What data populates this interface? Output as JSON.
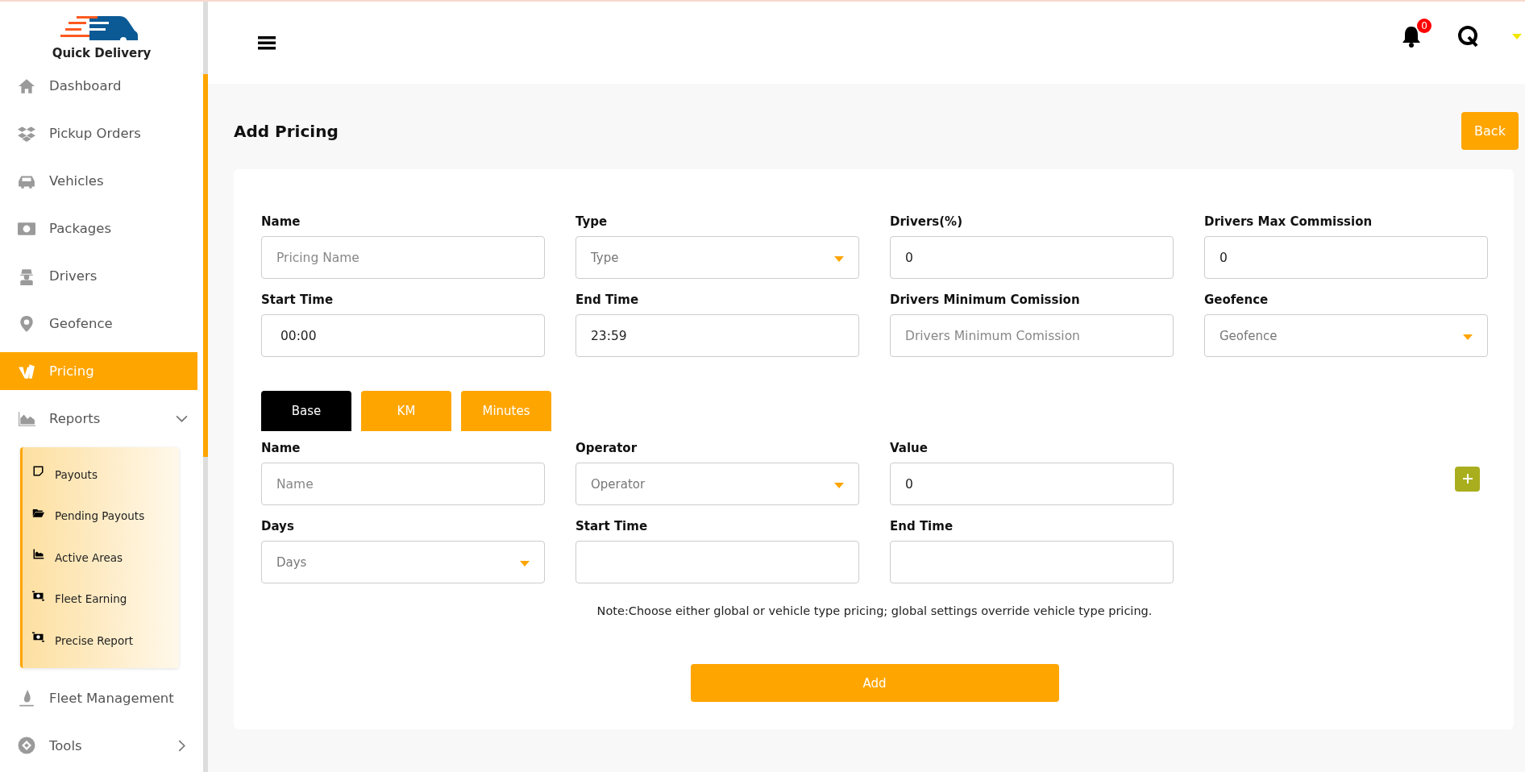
{
  "brand": {
    "name": "Quick Delivery"
  },
  "sidebar": {
    "items": [
      {
        "label": "Dashboard",
        "selected": false
      },
      {
        "label": "Pickup Orders",
        "selected": false
      },
      {
        "label": "Vehicles",
        "selected": false
      },
      {
        "label": "Packages",
        "selected": false
      },
      {
        "label": "Drivers",
        "selected": false
      },
      {
        "label": "Geofence",
        "selected": false
      },
      {
        "label": "Pricing",
        "selected": true
      },
      {
        "label": "Reports",
        "selected": false,
        "expanded": true,
        "children": [
          {
            "label": "Payouts",
            "selected": false
          },
          {
            "label": "Pending Payouts",
            "selected": false
          },
          {
            "label": "Active Areas",
            "selected": false
          },
          {
            "label": "Fleet Earning",
            "selected": false
          },
          {
            "label": "Precise Report",
            "selected": false
          }
        ]
      },
      {
        "label": "Fleet Management",
        "selected": false
      },
      {
        "label": "Tools",
        "selected": false,
        "expanded": false
      }
    ]
  },
  "header": {
    "notifications": "0"
  },
  "page": {
    "title": "Add Pricing",
    "back_button": "Back"
  },
  "form": {
    "fields": [
      {
        "label": "Name",
        "kind": "text",
        "placeholder": "Pricing Name"
      },
      {
        "label": "Type",
        "kind": "select",
        "placeholder": "Type"
      },
      {
        "label": "Drivers(%)",
        "kind": "text",
        "value": "0"
      },
      {
        "label": "Drivers Max Commission",
        "kind": "text",
        "value": "0"
      },
      {
        "label": "Start Time",
        "kind": "text",
        "value": " 00:00"
      },
      {
        "label": "End Time",
        "kind": "text",
        "value": "23:59"
      },
      {
        "label": "Drivers Minimum Comission",
        "kind": "text",
        "placeholder": "Drivers Minimum Comission"
      },
      {
        "label": "Geofence",
        "kind": "select",
        "placeholder": "Geofence"
      }
    ],
    "tabs": [
      {
        "label": "Base",
        "selected": true
      },
      {
        "label": "KM",
        "selected": false
      },
      {
        "label": "Minutes",
        "selected": false
      }
    ],
    "rule_fields": [
      {
        "label": "Name",
        "kind": "text",
        "placeholder": "Name"
      },
      {
        "label": "Operator",
        "kind": "select",
        "placeholder": "Operator"
      },
      {
        "label": "Value",
        "kind": "text",
        "value": "0"
      },
      {
        "kind": "add"
      },
      {
        "label": "Days",
        "kind": "select",
        "placeholder": "Days"
      },
      {
        "label": "Start Time",
        "kind": "text"
      },
      {
        "label": "End Time",
        "kind": "text"
      }
    ],
    "note": "Note:Choose either global or vehicle type pricing; global settings override vehicle type pricing.",
    "submit": "Add"
  }
}
